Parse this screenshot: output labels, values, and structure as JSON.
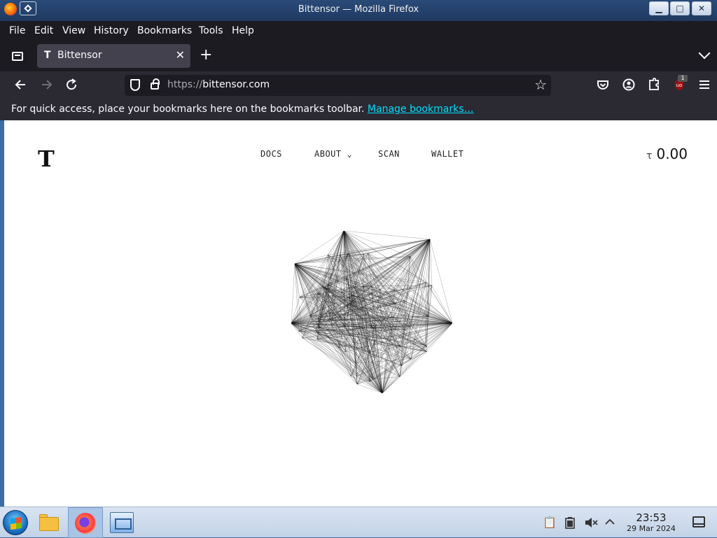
{
  "window": {
    "title": "Bittensor — Mozilla Firefox",
    "buttons": {
      "minimize": "▁",
      "maximize": "□",
      "close": "✕"
    }
  },
  "menu": [
    "File",
    "Edit",
    "View",
    "History",
    "Bookmarks",
    "Tools",
    "Help"
  ],
  "tabs": [
    {
      "favicon": "T",
      "label": "Bittensor",
      "close": "✕"
    }
  ],
  "new_tab_label": "+",
  "urlbar": {
    "scheme": "https://",
    "host": "bittensor.com"
  },
  "toolbar_icons": [
    "back-icon",
    "forward-icon",
    "reload-icon",
    "pocket-icon",
    "account-icon",
    "extensions-icon",
    "ublock-icon",
    "app-menu-icon"
  ],
  "extension_badge": "1",
  "bookmarks_bar": {
    "message": "For quick access, place your bookmarks here on the bookmarks toolbar.",
    "link": "Manage bookmarks…"
  },
  "site": {
    "logo": "T",
    "nav": [
      "DOCS",
      "ABOUT",
      "SCAN",
      "WALLET"
    ],
    "about_chevron": "⌄",
    "balance_symbol": "τ",
    "balance_amount": "0.00"
  },
  "taskbar": {
    "clock_time": "23:53",
    "clock_date": "29 Mar 2024",
    "tray_icons": [
      "clipboard-icon",
      "battery-icon",
      "volume-muted-icon",
      "tray-expand-icon"
    ]
  },
  "colors": {
    "chrome_dark": "#1c1b22",
    "toolbar": "#2b2a33",
    "link": "#00ddff",
    "page_bg": "#ffffff"
  }
}
